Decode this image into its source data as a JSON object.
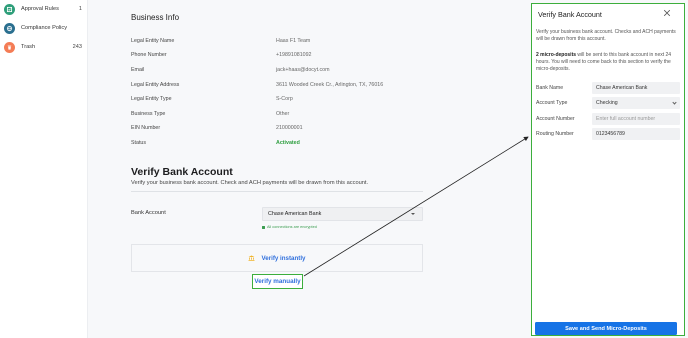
{
  "sidebar": {
    "items": [
      {
        "label": "Approval Rules",
        "count": "1",
        "icon": "checklist-icon",
        "color": "#2e9e7a"
      },
      {
        "label": "Compliance Policy",
        "count": "",
        "icon": "globe-icon",
        "color": "#2a6f8f"
      },
      {
        "label": "Trash",
        "count": "243",
        "icon": "trash-icon",
        "color": "#f47c55"
      }
    ]
  },
  "business_info": {
    "title": "Business Info",
    "rows": [
      {
        "label": "Legal Entity Name",
        "value": "Haas F1 Team"
      },
      {
        "label": "Phone Number",
        "value": "+19891081092"
      },
      {
        "label": "Email",
        "value": "jack+haas@docyt.com"
      },
      {
        "label": "Legal Entity Address",
        "value": "3611 Wooded Creek Cr., Arlington, TX, 76016"
      },
      {
        "label": "Legal Entity Type",
        "value": "S-Corp"
      },
      {
        "label": "Business Type",
        "value": "Other"
      },
      {
        "label": "EIN Number",
        "value": "210000001"
      },
      {
        "label": "Status",
        "value": "Activated"
      }
    ]
  },
  "verify": {
    "title": "Verify Bank Account",
    "subtitle": "Verify your business bank account. Check and ACH payments will be drawn from this account.",
    "bank_label": "Bank Account",
    "bank_value": "Chase American Bank",
    "encrypted_note": "All connections are encrypted",
    "instant_label": "Verify instantly",
    "manual_label": "Verify manually"
  },
  "panel": {
    "title": "Verify Bank Account",
    "desc": "Verify your business bank account. Checks and ACH payments will be drawn from this account.",
    "desc2_bold": "2 micro-deposits",
    "desc2_rest": " will be sent to this bank account in next 24 hours. You will need to come back to this section to verify the micro-deposits.",
    "fields": {
      "bank_name_label": "Bank Name",
      "bank_name_value": "Chase American Bank",
      "account_type_label": "Account Type",
      "account_type_value": "Checking",
      "account_number_label": "Account Number",
      "account_number_placeholder": "Enter full account number",
      "routing_number_label": "Routing Number",
      "routing_number_value": "0123456789"
    },
    "submit_label": "Save and Send Micro-Deposits"
  },
  "colors": {
    "accent_blue": "#1673e6",
    "link_blue": "#2f6fdd",
    "highlight_green": "#3cae3c",
    "status_green": "#2e9e3f"
  }
}
